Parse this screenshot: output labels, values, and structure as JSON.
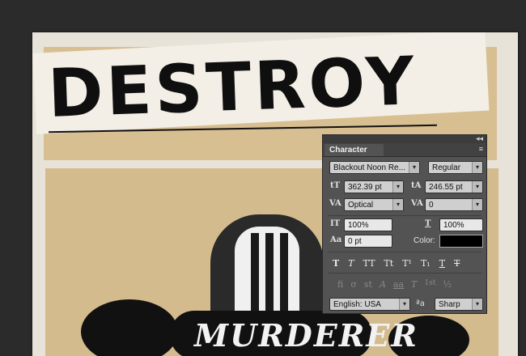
{
  "artwork": {
    "title": "DESTROY",
    "subtitle": "MURDERER"
  },
  "panel": {
    "tab_label": "Character",
    "collapse_glyph": "◂◂",
    "menu_glyph": "≡",
    "font_family": "Blackout Noon Re...",
    "font_style": "Regular",
    "font_size": "362.39 pt",
    "leading": "246.55 pt",
    "kerning": "Optical",
    "tracking": "0",
    "vertical_scale": "100%",
    "horizontal_scale": "100%",
    "baseline_shift": "0 pt",
    "color_label": "Color:",
    "color_value": "#000000",
    "type_styles": [
      "T",
      "T",
      "TT",
      "Tt",
      "T¹",
      "T₁",
      "T",
      "T"
    ],
    "opentype": [
      "fi",
      "σ",
      "st",
      "A",
      "aa",
      "T",
      "1st",
      "½"
    ],
    "language": "English: USA",
    "aa_glyph": "ªa",
    "anti_alias": "Sharp",
    "icons": {
      "size": "tT",
      "leading": "tA",
      "kerning": "VA",
      "tracking": "VA",
      "vscale": "IT",
      "hscale": "T",
      "baseline": "Aa"
    }
  }
}
